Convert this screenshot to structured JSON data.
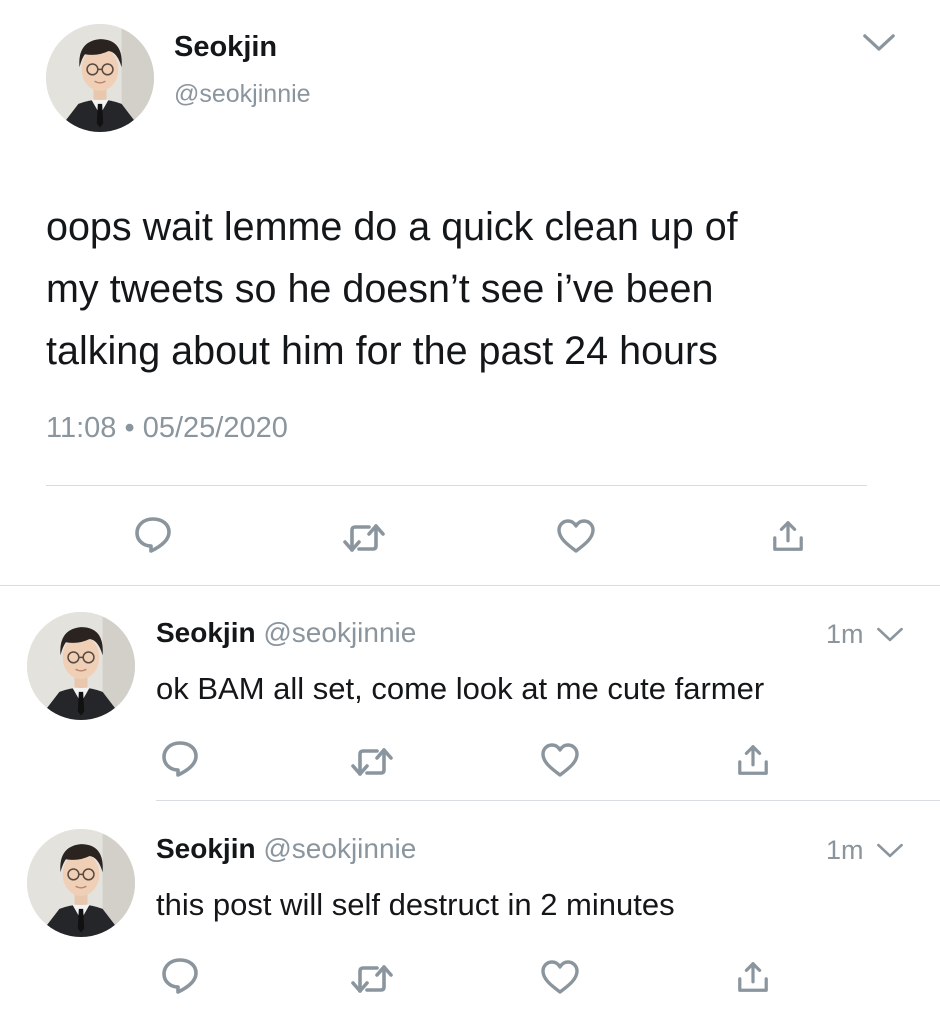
{
  "main_tweet": {
    "name": "Seokjin",
    "handle": "@seokjinnie",
    "text_lines": [
      "oops wait lemme do a quick clean up of",
      "my tweets so he doesn’t see i’ve been",
      "talking about him for the past 24 hours"
    ],
    "time": "11:08",
    "separator": "•",
    "date": "05/25/2020"
  },
  "replies": [
    {
      "name": "Seokjin",
      "handle": "@seokjinnie",
      "age": "1m",
      "text": "ok BAM all set, come look at me cute farmer"
    },
    {
      "name": "Seokjin",
      "handle": "@seokjinnie",
      "age": "1m",
      "text": "this post will self destruct in 2 minutes"
    }
  ],
  "icons": {
    "reply": "speech-bubble-icon",
    "retweet": "retweet-arrows-icon",
    "like": "heart-outline-icon",
    "share": "share-upload-icon",
    "more": "chevron-down-icon"
  },
  "colors": {
    "text": "#14171a",
    "muted": "#8a959e",
    "divider": "#d9dde1"
  }
}
